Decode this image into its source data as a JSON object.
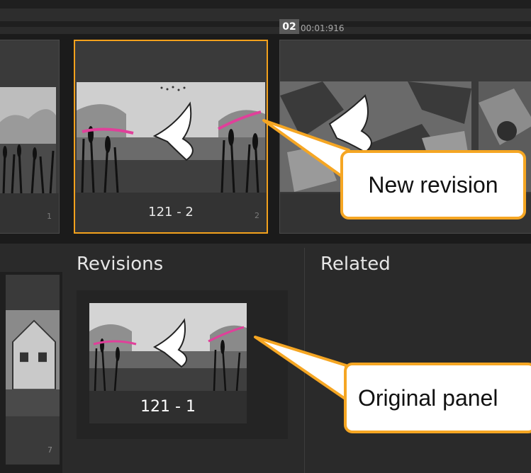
{
  "header": {
    "shot_number": "02",
    "timecode": "00:01:916"
  },
  "story_row": {
    "panels": [
      {
        "name": "",
        "index": "1"
      },
      {
        "name": "121 - 2",
        "index": "2",
        "selected": true
      },
      {
        "name": "",
        "index": ""
      }
    ]
  },
  "sidebar_panel": {
    "index": "7"
  },
  "revisions": {
    "heading": "Revisions",
    "items": [
      {
        "name": "121 - 1"
      }
    ]
  },
  "related": {
    "heading": "Related"
  },
  "callouts": {
    "new_revision": "New revision",
    "original_panel": "Original panel"
  },
  "colors": {
    "accent": "#f3a11c",
    "callout_border": "#f5a623",
    "arrow_pink": "#e0409a"
  }
}
